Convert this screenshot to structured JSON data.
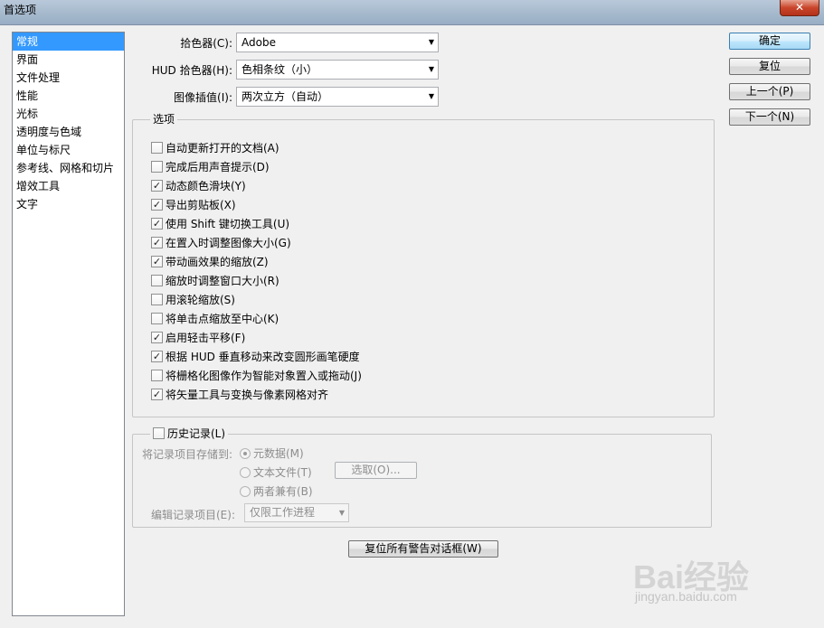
{
  "window": {
    "title": "首选项",
    "close_glyph": "✕"
  },
  "sidebar": {
    "items": [
      {
        "label": "常规",
        "selected": true
      },
      {
        "label": "界面"
      },
      {
        "label": "文件处理"
      },
      {
        "label": "性能"
      },
      {
        "label": "光标"
      },
      {
        "label": "透明度与色域"
      },
      {
        "label": "单位与标尺"
      },
      {
        "label": "参考线、网格和切片"
      },
      {
        "label": "增效工具"
      },
      {
        "label": "文字"
      }
    ]
  },
  "general": {
    "color_picker": {
      "label": "拾色器(C):",
      "value": "Adobe"
    },
    "hud_picker": {
      "label": "HUD 拾色器(H):",
      "value": "色相条纹（小）"
    },
    "interpolation": {
      "label": "图像插值(I):",
      "value": "两次立方（自动）"
    }
  },
  "options": {
    "legend": "选项",
    "items": [
      {
        "label": "自动更新打开的文档(A)",
        "checked": false
      },
      {
        "label": "完成后用声音提示(D)",
        "checked": false
      },
      {
        "label": "动态颜色滑块(Y)",
        "checked": true
      },
      {
        "label": "导出剪贴板(X)",
        "checked": true
      },
      {
        "label": "使用 Shift 键切换工具(U)",
        "checked": true
      },
      {
        "label": "在置入时调整图像大小(G)",
        "checked": true
      },
      {
        "label": "带动画效果的缩放(Z)",
        "checked": true
      },
      {
        "label": "缩放时调整窗口大小(R)",
        "checked": false
      },
      {
        "label": "用滚轮缩放(S)",
        "checked": false
      },
      {
        "label": "将单击点缩放至中心(K)",
        "checked": false
      },
      {
        "label": "启用轻击平移(F)",
        "checked": true
      },
      {
        "label": "根据 HUD 垂直移动来改变圆形画笔硬度",
        "checked": true
      },
      {
        "label": "将栅格化图像作为智能对象置入或拖动(J)",
        "checked": false
      },
      {
        "label": "将矢量工具与变换与像素网格对齐",
        "checked": true
      }
    ]
  },
  "history": {
    "legend": "历史记录(L)",
    "checked": false,
    "save_to_label": "将记录项目存储到:",
    "radios": [
      {
        "label": "元数据(M)",
        "selected": true
      },
      {
        "label": "文本文件(T)",
        "selected": false
      },
      {
        "label": "两者兼有(B)",
        "selected": false
      }
    ],
    "choose_button": "选取(O)...",
    "edit_log_label": "编辑记录项目(E):",
    "edit_log_value": "仅限工作进程"
  },
  "reset_warnings_button": "复位所有警告对话框(W)",
  "buttons": {
    "ok": "确定",
    "reset": "复位",
    "prev": "上一个(P)",
    "next": "下一个(N)"
  },
  "watermark": {
    "main": "Bai经验",
    "sub": "jingyan.baidu.com"
  }
}
